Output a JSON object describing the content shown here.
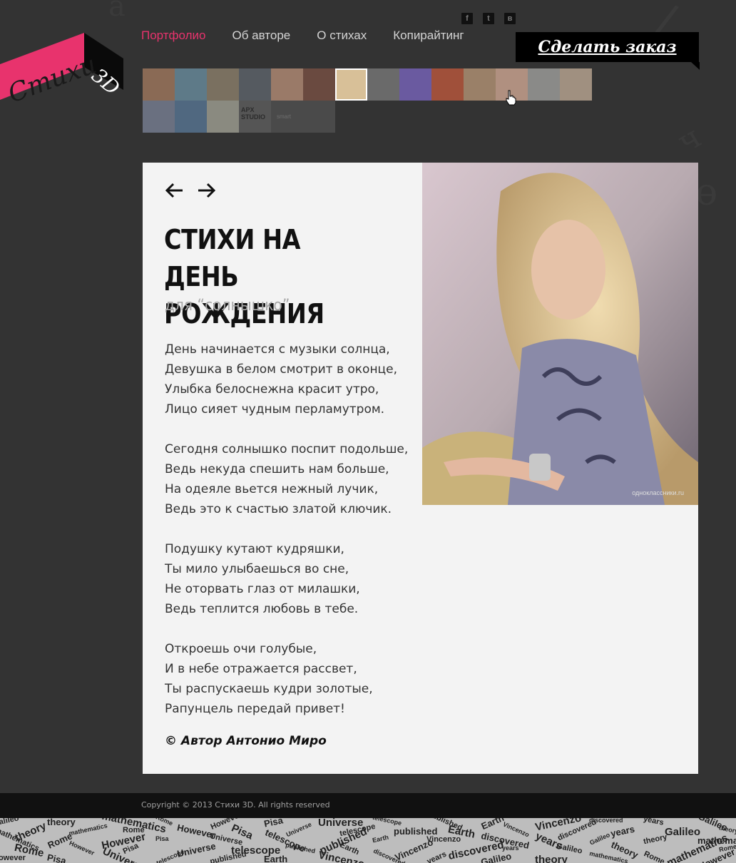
{
  "logo": {
    "text": "Стихи",
    "badge": "3D"
  },
  "nav": {
    "items": [
      {
        "label": "Портфолио",
        "active": true
      },
      {
        "label": "Об авторе",
        "active": false
      },
      {
        "label": "О стихах",
        "active": false
      },
      {
        "label": "Копирайтинг",
        "active": false
      }
    ]
  },
  "social": {
    "icons": [
      "facebook-icon",
      "twitter-icon",
      "vkontakte-icon"
    ],
    "glyphs": [
      "f",
      "t",
      "в"
    ]
  },
  "order_button": {
    "label": "Сделать заказ"
  },
  "thumbnails": {
    "row1_colors": [
      "#8a6a55",
      "#5e7a88",
      "#7a7060",
      "#555a60",
      "#9a7a68",
      "#6a4a40",
      "#d8c098",
      "#6a6a6a",
      "#6a5aa0",
      "#a0503a",
      "#9a8068",
      "#b09080",
      "#8a8a88",
      "#a09080"
    ],
    "row2_colors": [
      "#6a7080",
      "#506880",
      "#8a8a80"
    ],
    "apx_text": "APX STUDIO",
    "smart_text": "smart",
    "selected_index": 6
  },
  "article": {
    "title": "СТИХИ НА ДЕНЬ РОЖДЕНИЯ",
    "subtitle": "для “солнышко”",
    "stanzas": [
      [
        "День начинается с музыки солнца,",
        "Девушка в белом смотрит в оконце,",
        "Улыбка белоснежна красит утро,",
        "Лицо сияет чудным перламутром."
      ],
      [
        "Сегодня солнышко поспит подольше,",
        "Ведь некуда спешить нам больше,",
        "На одеяле вьется нежный лучик,",
        "Ведь это к счастью златой ключик."
      ],
      [
        "Подушку кутают кудряшки,",
        "Ты мило улыбаешься во сне,",
        "Не оторвать глаз от милашки,",
        "Ведь теплится любовь в тебе."
      ],
      [
        "Откроешь очи голубые,",
        "И в небе отражается рассвет,",
        "Ты распускаешь кудри золотые,",
        "Рапунцель передай привет!"
      ]
    ],
    "author": "© Автор Антонио Миро",
    "photo_watermark": "одноклассники.ru"
  },
  "footer": {
    "copyright": "Copyright © 2013 Стихи 3D. All rights reserved"
  },
  "footer_words": [
    "Galileo",
    "theory",
    "mathematics",
    "Rome",
    "However",
    "Pisa",
    "Universe",
    "telescope",
    "published",
    "Earth",
    "Vincenzo",
    "discovered",
    "years"
  ],
  "colors": {
    "accent": "#e8336d",
    "background": "#333333",
    "card": "#f3f3f3",
    "footer": "#111111"
  }
}
